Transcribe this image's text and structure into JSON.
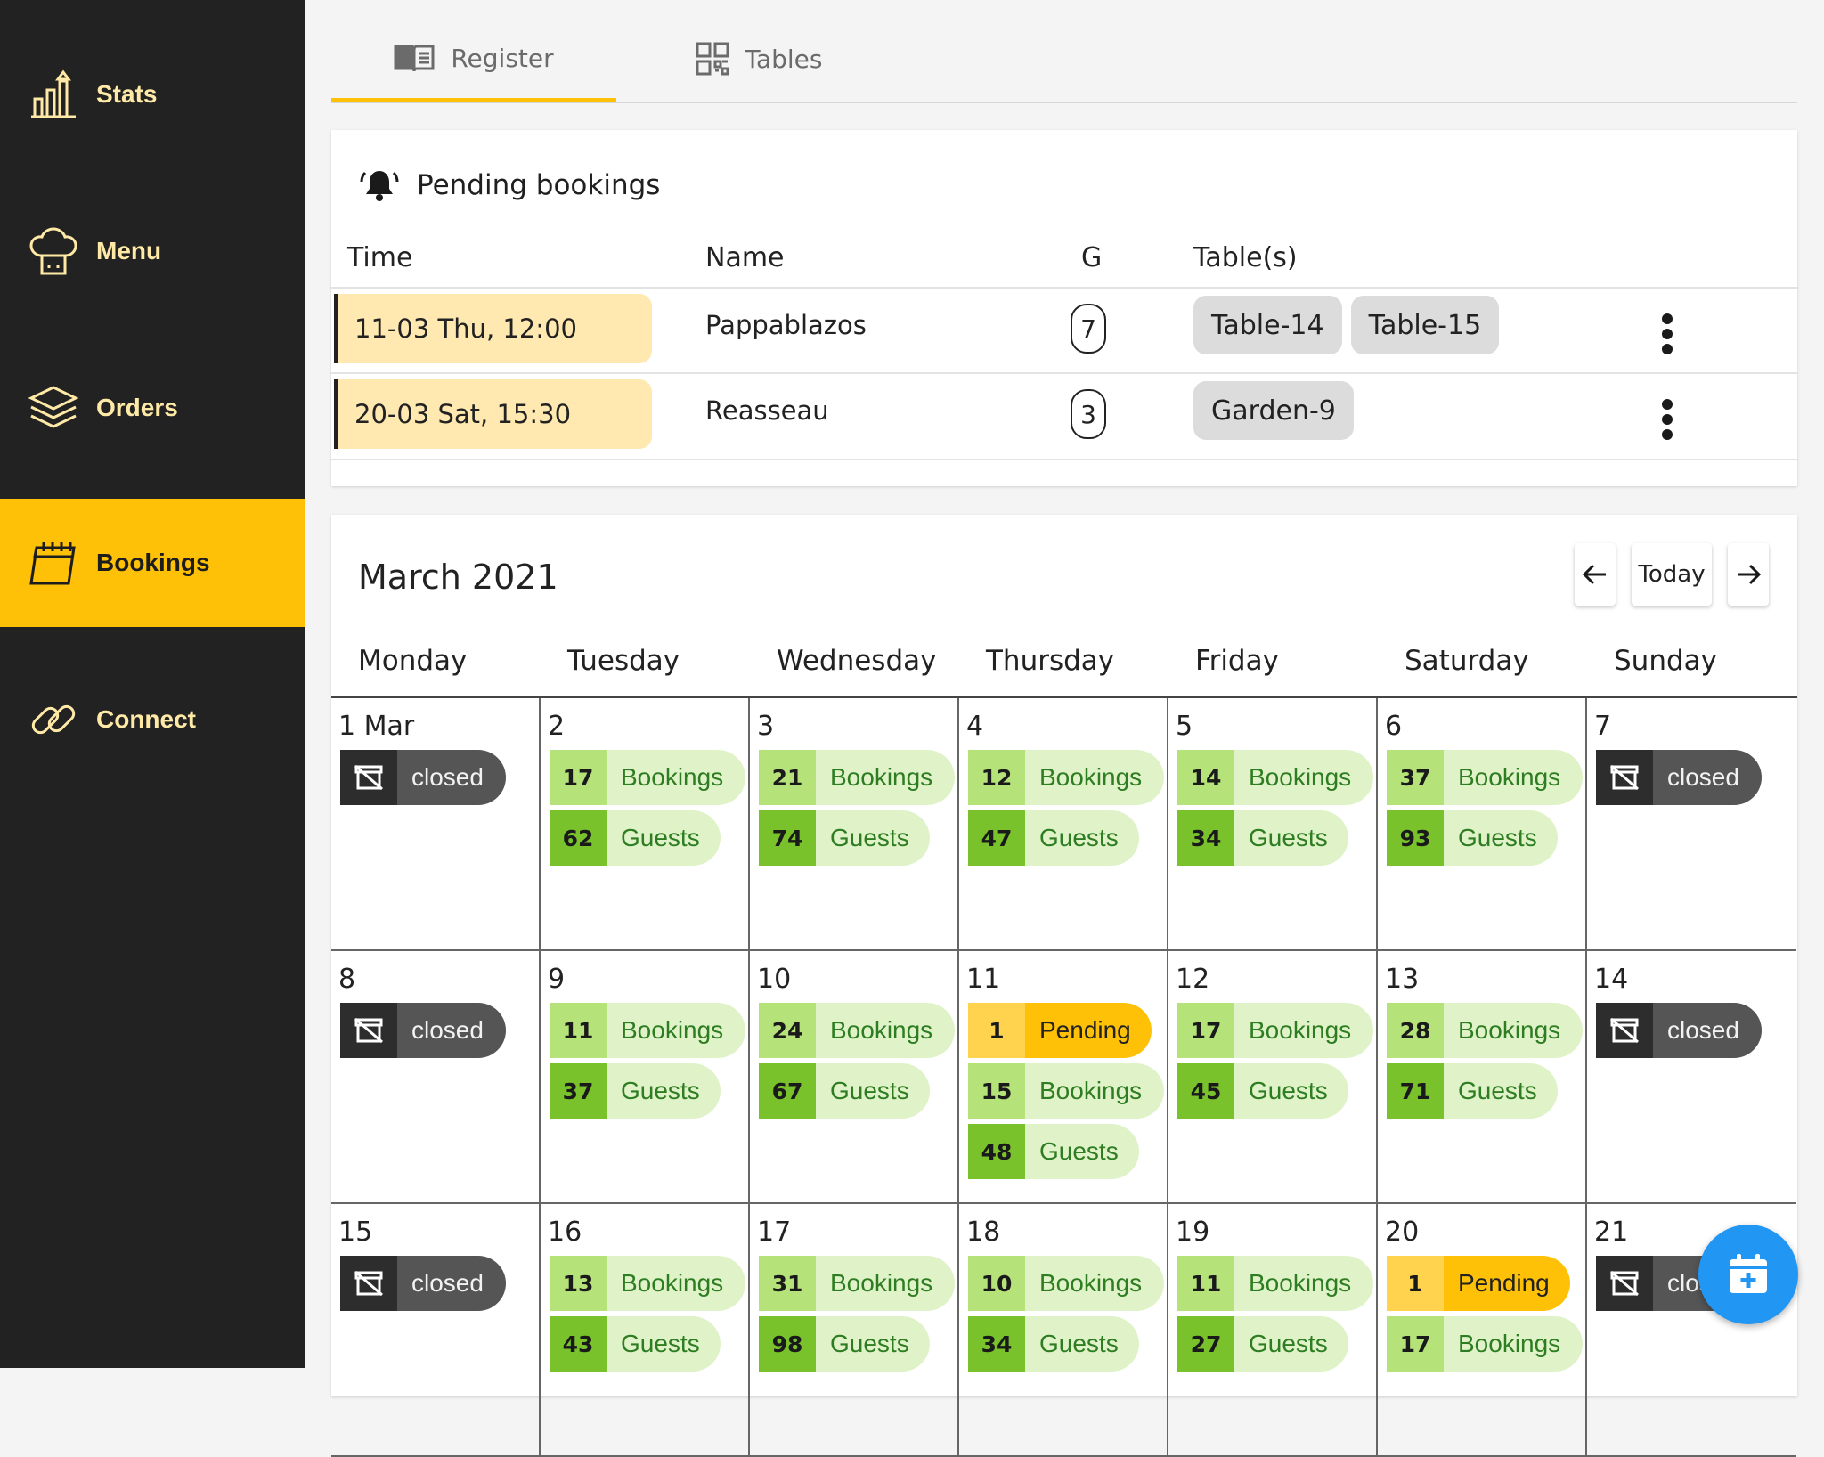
{
  "sidebar": {
    "items": [
      {
        "label": "Stats",
        "icon": "stats-chart-icon"
      },
      {
        "label": "Menu",
        "icon": "chef-hat-icon"
      },
      {
        "label": "Orders",
        "icon": "layers-icon"
      },
      {
        "label": "Bookings",
        "icon": "calendar-icon",
        "active": true
      },
      {
        "label": "Connect",
        "icon": "link-icon"
      }
    ]
  },
  "tabs": [
    {
      "label": "Register",
      "icon": "book-icon",
      "active": true
    },
    {
      "label": "Tables",
      "icon": "qr-code-icon"
    }
  ],
  "pending": {
    "title": "Pending bookings",
    "columns": {
      "time": "Time",
      "name": "Name",
      "guests": "G",
      "tables": "Table(s)"
    },
    "rows": [
      {
        "time": "11-03 Thu, 12:00",
        "name": "Pappablazos",
        "guests": "7",
        "tables": [
          "Table-14",
          "Table-15"
        ]
      },
      {
        "time": "20-03 Sat, 15:30",
        "name": "Reasseau",
        "guests": "3",
        "tables": [
          "Garden-9"
        ]
      }
    ]
  },
  "calendar": {
    "month": "March 2021",
    "today_label": "Today",
    "weekdays": [
      "Monday",
      "Tuesday",
      "Wednesday",
      "Thursday",
      "Friday",
      "Saturday",
      "Sunday"
    ],
    "labels": {
      "bookings": "Bookings",
      "guests": "Guests",
      "pending": "Pending",
      "closed": "closed"
    },
    "days": [
      {
        "d": "1 Mar",
        "closed": true
      },
      {
        "d": "2",
        "bookings": "17",
        "guests": "62"
      },
      {
        "d": "3",
        "bookings": "21",
        "guests": "74"
      },
      {
        "d": "4",
        "bookings": "12",
        "guests": "47"
      },
      {
        "d": "5",
        "bookings": "14",
        "guests": "34"
      },
      {
        "d": "6",
        "bookings": "37",
        "guests": "93"
      },
      {
        "d": "7",
        "closed": true
      },
      {
        "d": "8",
        "closed": true
      },
      {
        "d": "9",
        "bookings": "11",
        "guests": "37"
      },
      {
        "d": "10",
        "bookings": "24",
        "guests": "67"
      },
      {
        "d": "11",
        "pending": "1",
        "bookings": "15",
        "guests": "48"
      },
      {
        "d": "12",
        "bookings": "17",
        "guests": "45"
      },
      {
        "d": "13",
        "bookings": "28",
        "guests": "71"
      },
      {
        "d": "14",
        "closed": true
      },
      {
        "d": "15",
        "closed": true
      },
      {
        "d": "16",
        "bookings": "13",
        "guests": "43"
      },
      {
        "d": "17",
        "bookings": "31",
        "guests": "98"
      },
      {
        "d": "18",
        "bookings": "10",
        "guests": "34"
      },
      {
        "d": "19",
        "bookings": "11",
        "guests": "27"
      },
      {
        "d": "20",
        "pending": "1",
        "bookings": "17"
      },
      {
        "d": "21",
        "closed": true
      }
    ]
  },
  "colors": {
    "accent": "#ffc107",
    "sidebar": "#222222",
    "fab": "#2196f3",
    "bookings": "#b6e27a",
    "guests": "#79c22c"
  }
}
